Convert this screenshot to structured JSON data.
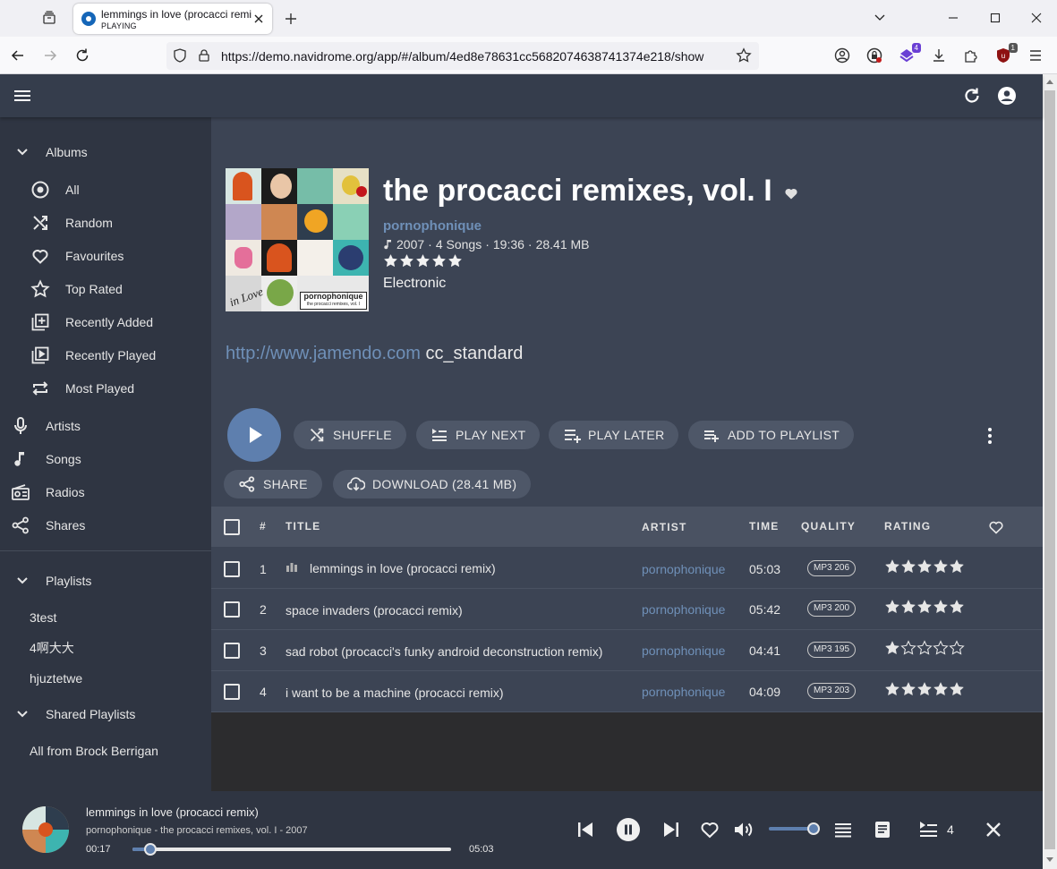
{
  "browser": {
    "tab": {
      "title": "lemmings in love (procacci remix)",
      "subtitle": "PLAYING"
    },
    "url": "https://demo.navidrome.org/app/#/album/4ed8e78631cc5682074638741374e218/show",
    "ext_badges": {
      "ext1": "4",
      "ext2": "1"
    },
    "colors": {
      "tabbar": "#f0f0f4",
      "ext1": "#6a3fd4",
      "ext2": "#c21a1a"
    }
  },
  "sidebar": {
    "albums_label": "Albums",
    "album_items": [
      {
        "label": "All",
        "icon": "album-icon"
      },
      {
        "label": "Random",
        "icon": "shuffle-icon"
      },
      {
        "label": "Favourites",
        "icon": "heart-icon"
      },
      {
        "label": "Top Rated",
        "icon": "star-icon"
      },
      {
        "label": "Recently Added",
        "icon": "library-add-icon"
      },
      {
        "label": "Recently Played",
        "icon": "video-library-icon"
      },
      {
        "label": "Most Played",
        "icon": "repeat-icon"
      }
    ],
    "main_items": [
      {
        "label": "Artists",
        "icon": "mic-icon"
      },
      {
        "label": "Songs",
        "icon": "music-note-icon"
      },
      {
        "label": "Radios",
        "icon": "radio-icon"
      },
      {
        "label": "Shares",
        "icon": "share-icon"
      }
    ],
    "playlists_label": "Playlists",
    "playlists": [
      "3test",
      "4啊大大",
      "hjuztetwe"
    ],
    "shared_playlists_label": "Shared Playlists",
    "shared_playlists": [
      "All from Brock Berrigan"
    ]
  },
  "album": {
    "title": "the procacci remixes, vol. I",
    "artist": "pornophonique",
    "year": "2007",
    "songs": "4 Songs",
    "duration": "19:36",
    "size": "28.41 MB",
    "rating": 5,
    "genre": "Electronic",
    "notes_link": "http://www.jamendo.com",
    "notes_text": "cc_standard",
    "cover_text": "pornophonique",
    "cover_subtext": "the procacci remixes, vol. I",
    "cover_handwriting": "in Love"
  },
  "actions": {
    "shuffle": "SHUFFLE",
    "play_next": "PLAY NEXT",
    "play_later": "PLAY LATER",
    "add_to_playlist": "ADD TO PLAYLIST",
    "share": "SHARE",
    "download": "DOWNLOAD (28.41 MB)"
  },
  "table": {
    "headers": {
      "num": "#",
      "title": "TITLE",
      "artist": "ARTIST",
      "time": "TIME",
      "quality": "QUALITY",
      "rating": "RATING"
    },
    "rows": [
      {
        "num": "1",
        "title": "lemmings in love (procacci remix)",
        "artist": "pornophonique",
        "time": "05:03",
        "quality": "MP3 206",
        "rating": 5,
        "playing": true
      },
      {
        "num": "2",
        "title": "space invaders (procacci remix)",
        "artist": "pornophonique",
        "time": "05:42",
        "quality": "MP3 200",
        "rating": 5,
        "playing": false
      },
      {
        "num": "3",
        "title": "sad robot (procacci's funky android deconstruction remix)",
        "artist": "pornophonique",
        "time": "04:41",
        "quality": "MP3 195",
        "rating": 1,
        "playing": false
      },
      {
        "num": "4",
        "title": "i want to be a machine (procacci remix)",
        "artist": "pornophonique",
        "time": "04:09",
        "quality": "MP3 203",
        "rating": 5,
        "playing": false
      }
    ]
  },
  "player": {
    "title": "lemmings in love (procacci remix)",
    "subtitle": "pornophonique - the procacci remixes, vol. I - 2007",
    "current": "00:17",
    "duration": "05:03",
    "progress": 0.056,
    "volume": 1.0,
    "queue_count": "4"
  },
  "colors": {
    "accent": "#5e7fae",
    "link": "#6f90b8",
    "background": "#3c4454",
    "sidebar": "#2f3542"
  }
}
